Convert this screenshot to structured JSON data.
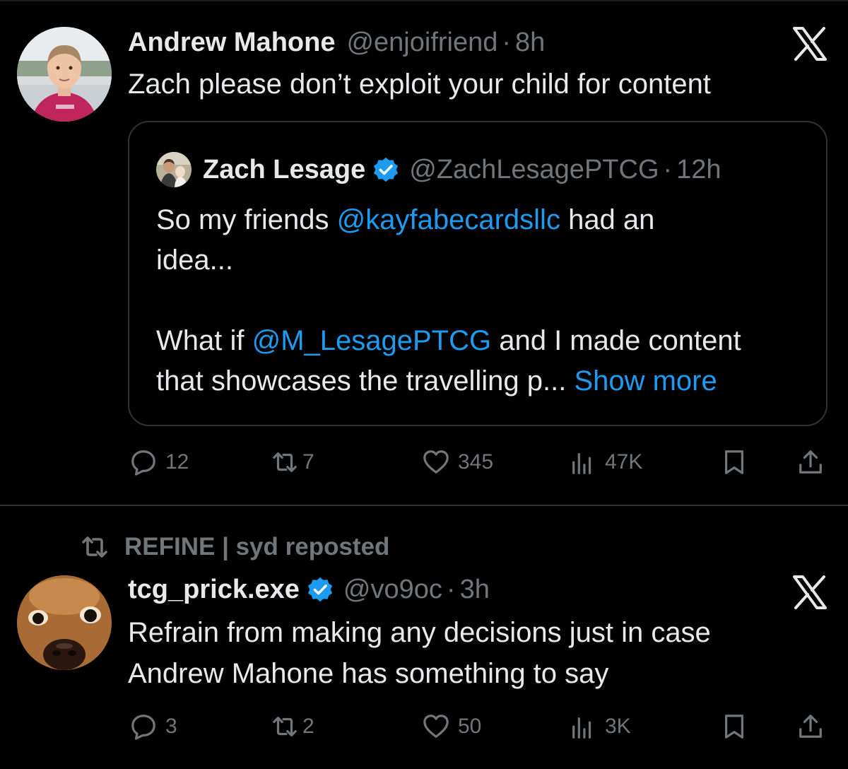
{
  "colors": {
    "background": "#000000",
    "text": "#e7e9ea",
    "muted": "#71767b",
    "link": "#1d9bf0",
    "border": "#2f3336"
  },
  "tweets": [
    {
      "display_name": "Andrew Mahone",
      "handle": "@enjoifriend",
      "separator": "·",
      "time": "8h",
      "text": "Zach please don’t exploit your child for content",
      "avatar_icon": "avatar-child-red-shirt",
      "corner_icon": "x-logo-icon",
      "quote": {
        "display_name": "Zach Lesage",
        "verified": true,
        "handle": "@ZachLesagePTCG",
        "separator": "·",
        "time": "12h",
        "line1_prefix": "So my friends ",
        "line1_mention": "@kayfabecardsllc",
        "line1_suffix": " had an",
        "line2": "idea...",
        "line3_prefix": "What if ",
        "line3_mention": "@M_LesagePTCG",
        "line3_suffix": " and I made content",
        "line4": "that showcases the travelling p... ",
        "show_more": "Show more"
      },
      "actions": {
        "replies": "12",
        "reposts": "7",
        "likes": "345",
        "views": "47K"
      }
    },
    {
      "repost_context": "REFINE | syd reposted",
      "display_name": "tcg_prick.exe",
      "verified": true,
      "handle": "@vo9oc",
      "separator": "·",
      "time": "3h",
      "text_line1": "Refrain from making any decisions just in case",
      "text_line2": "Andrew Mahone has something to say",
      "avatar_icon": "avatar-dog-closeup",
      "corner_icon": "x-logo-icon",
      "actions": {
        "replies": "3",
        "reposts": "2",
        "likes": "50",
        "views": "3K"
      }
    }
  ]
}
